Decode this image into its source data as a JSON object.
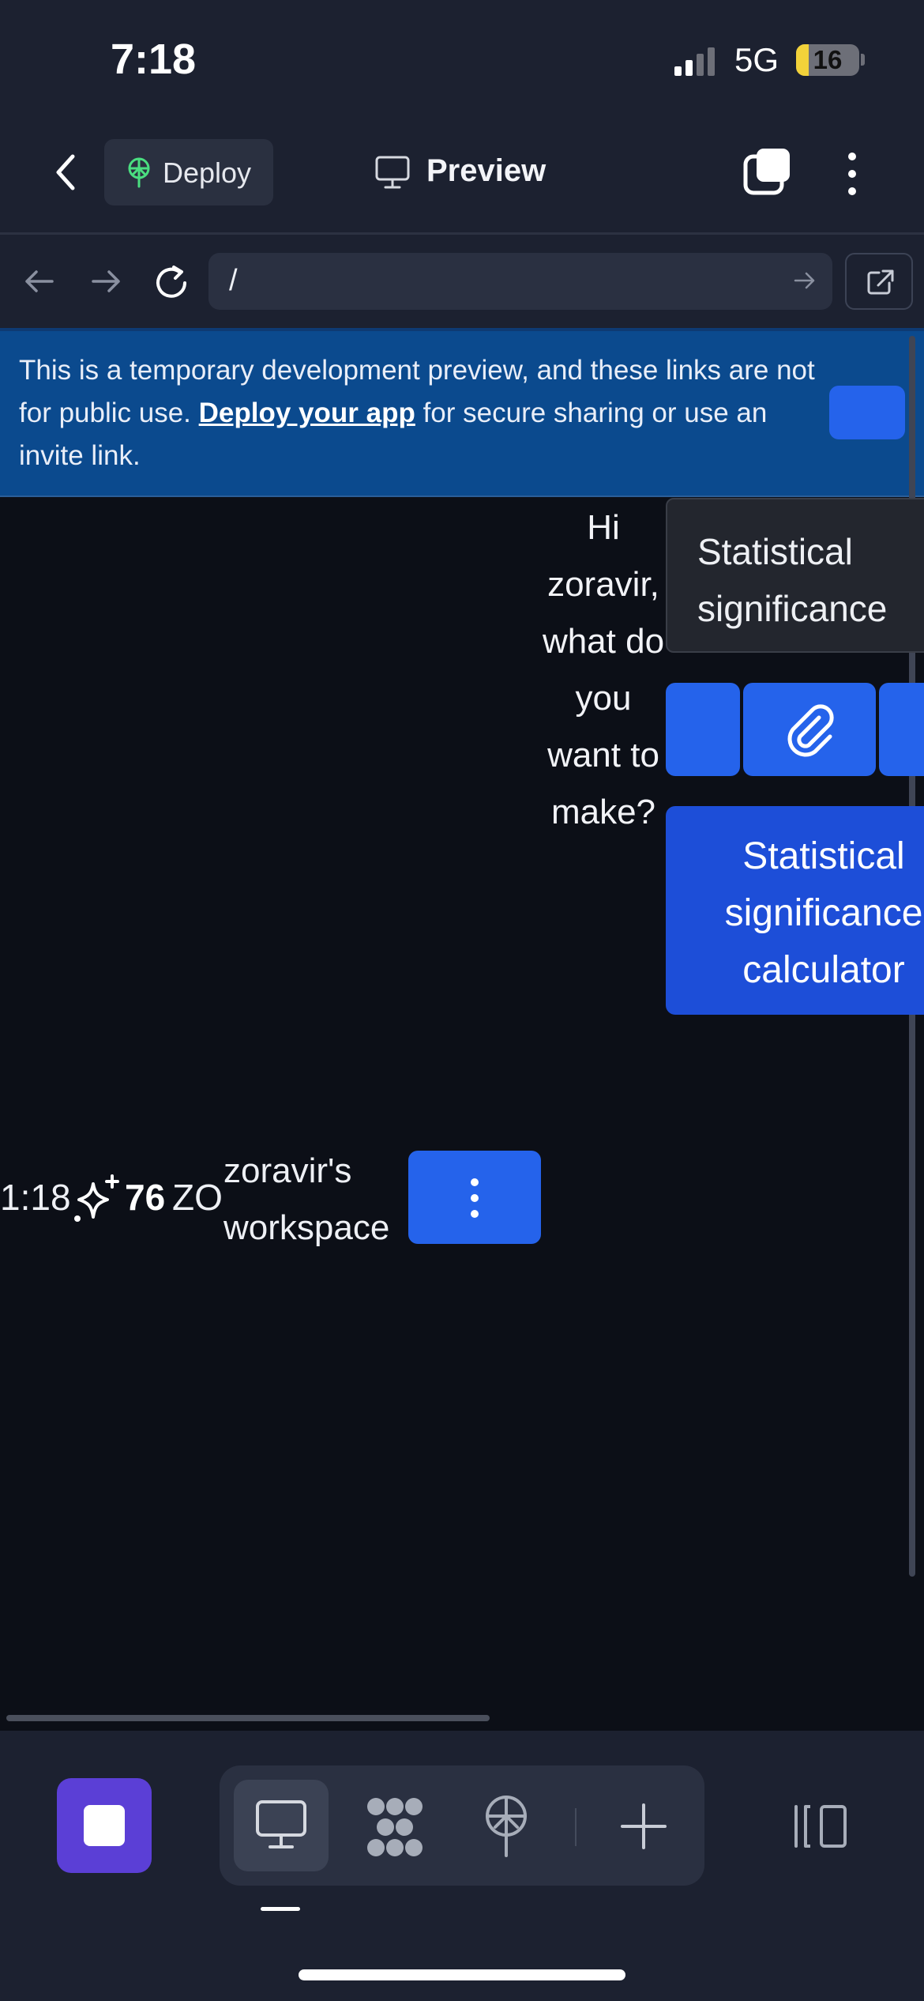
{
  "status_bar": {
    "time": "7:18",
    "network": "5G",
    "battery": "16"
  },
  "header": {
    "deploy_label": "Deploy",
    "title": "Preview"
  },
  "browser": {
    "url": "/"
  },
  "banner": {
    "text_before": "This is a temporary development preview, and these links are not for public use. ",
    "link_text": "Deploy your app",
    "text_after": " for secure sharing or use an invite link."
  },
  "app": {
    "greeting": "Hi zoravir, what do you want to make?",
    "prompt_value": "Statistical significance calculator",
    "submit_label": "Statistical significance calculator",
    "time": "1:18",
    "credits": "76",
    "initials": "ZO",
    "workspace": "zoravir's workspace"
  },
  "colors": {
    "accent": "#2563eb",
    "banner": "#0b4a8e",
    "stop": "#5b3fd6"
  }
}
